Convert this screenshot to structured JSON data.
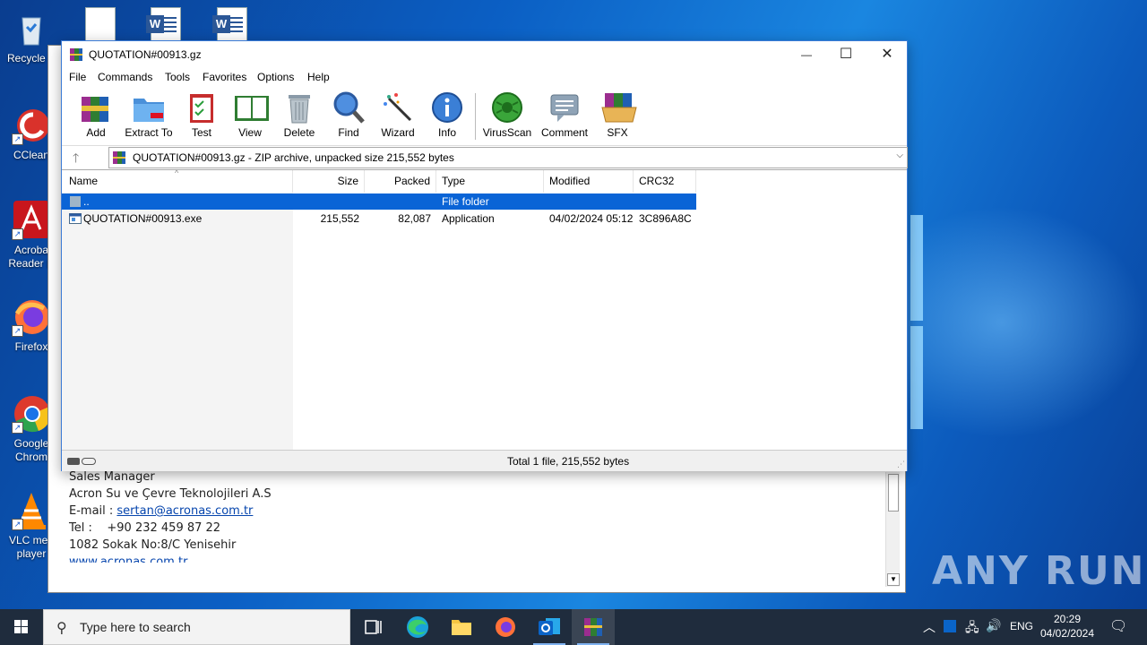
{
  "desktop": {
    "icons": [
      {
        "id": "recycle",
        "label": "Recycle B",
        "icon": "recycle-bin-icon"
      },
      {
        "id": "ccleaner",
        "label": "CClean",
        "icon": "ccleaner-icon"
      },
      {
        "id": "acrobat",
        "label": "Acroba\nReader D",
        "icon": "acrobat-icon"
      },
      {
        "id": "firefox",
        "label": "Firefox",
        "icon": "firefox-icon"
      },
      {
        "id": "chrome",
        "label": "Google\nChrom",
        "icon": "chrome-icon"
      },
      {
        "id": "vlc",
        "label": "VLC med\nplayer",
        "icon": "vlc-icon"
      }
    ],
    "watermark": "ANY RUN"
  },
  "background_doc": {
    "lines": [
      "Sales Manager",
      "Acron Su ve Çevre Teknolojileri A.S",
      "E-mail : ",
      "Tel :    +90 232 459 87 22",
      "1082 Sokak No:8/C Yenisehir",
      "www.acronas.com.tr"
    ],
    "email": "sertan@acronas.com.tr"
  },
  "window": {
    "title": "QUOTATION#00913.gz",
    "controls": {
      "minimize": "—",
      "maximize": "☐",
      "close": "✕"
    },
    "menu": [
      "File",
      "Commands",
      "Tools",
      "Favorites",
      "Options",
      "Help"
    ],
    "toolbar": [
      {
        "label": "Add",
        "icon": "add-archive-icon"
      },
      {
        "label": "Extract To",
        "icon": "extract-folder-icon"
      },
      {
        "label": "Test",
        "icon": "test-clipboard-icon"
      },
      {
        "label": "View",
        "icon": "view-book-icon"
      },
      {
        "label": "Delete",
        "icon": "delete-bin-icon"
      },
      {
        "label": "Find",
        "icon": "find-magnifier-icon"
      },
      {
        "label": "Wizard",
        "icon": "wizard-wand-icon"
      },
      {
        "label": "Info",
        "icon": "info-icon"
      },
      {
        "label": "VirusScan",
        "icon": "virus-scan-icon"
      },
      {
        "label": "Comment",
        "icon": "comment-icon"
      },
      {
        "label": "SFX",
        "icon": "sfx-box-icon"
      }
    ],
    "address": "QUOTATION#00913.gz - ZIP archive, unpacked size 215,552 bytes",
    "columns": [
      "Name",
      "Size",
      "Packed",
      "Type",
      "Modified",
      "CRC32"
    ],
    "rows": [
      {
        "name": "..",
        "size": "",
        "packed": "",
        "type": "File folder",
        "modified": "",
        "crc": "",
        "selected": true
      },
      {
        "name": "QUOTATION#00913.exe",
        "size": "215,552",
        "packed": "82,087",
        "type": "Application",
        "modified": "04/02/2024 05:12",
        "crc": "3C896A8C",
        "selected": false
      }
    ],
    "status": "Total 1 file, 215,552 bytes"
  },
  "taskbar": {
    "search_placeholder": "Type here to search",
    "tray": {
      "language": "ENG"
    },
    "clock": {
      "time": "20:29",
      "date": "04/02/2024"
    }
  }
}
